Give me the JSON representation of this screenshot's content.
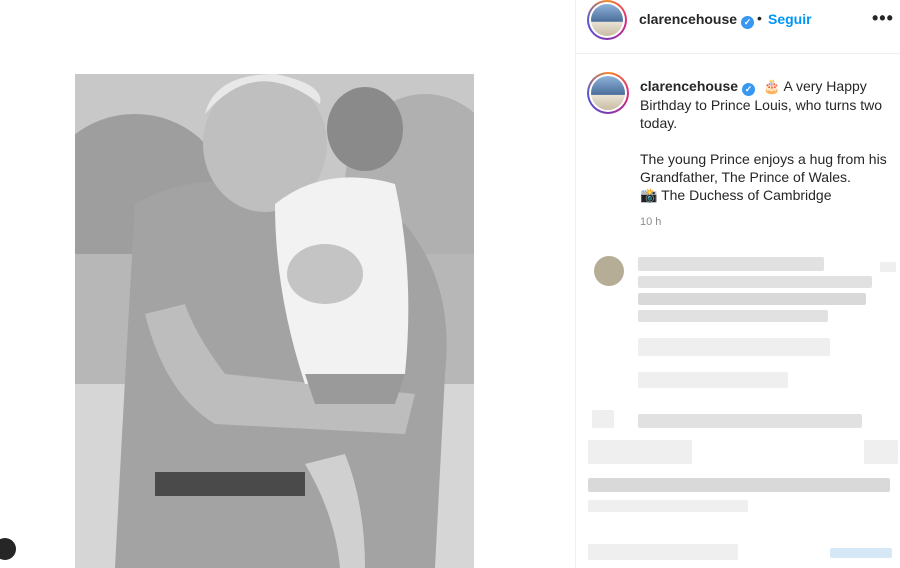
{
  "post": {
    "username": "clarencehouse",
    "verified_icon": "verified-badge-icon",
    "separator": "•",
    "follow_label": "Seguir",
    "more_icon": "more-options-icon",
    "more_label": "•••"
  },
  "caption": {
    "username": "clarencehouse",
    "emoji_cake": "🎂",
    "line1": "A very Happy Birthday to Prince Louis, who turns two today.",
    "line2": "The young Prince enjoys a hug from his Grandfather, The Prince of Wales.",
    "emoji_camera": "📸",
    "line3": "The Duchess of Cambridge",
    "timestamp": "10 h"
  },
  "media": {
    "photo_icon": "black-and-white-photo",
    "user_tag_icon": "user-tag-icon"
  },
  "colors": {
    "accent_blue": "#0095f6",
    "verified_blue": "#3897f0",
    "text": "#262626",
    "muted": "#8e8e8e"
  }
}
